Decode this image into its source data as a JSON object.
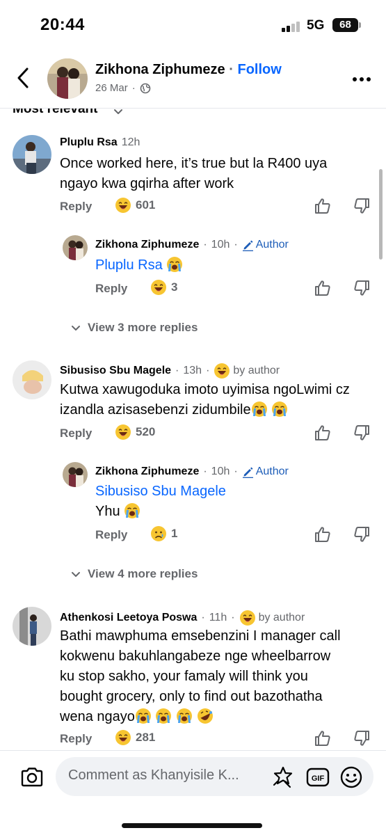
{
  "status_bar": {
    "time": "20:44",
    "network": "5G",
    "battery": "68"
  },
  "header": {
    "name": "Zikhona Ziphumeze",
    "separator": "·",
    "follow_label": "Follow",
    "date": "26 Mar",
    "date_sep": "·"
  },
  "sort": {
    "label": "Most relevant"
  },
  "comments": [
    {
      "name": "Pluplu Rsa",
      "time": "12h",
      "text": "Once worked here, it’s true but la R400 uya ngayo kwa gqirha after work",
      "reply_label": "Reply",
      "reaction_emoji": "laugh",
      "reaction_count": "601",
      "replies": [
        {
          "name": "Zikhona Ziphumeze",
          "time": "10h",
          "author_label": "Author",
          "mention": "Pluplu Rsa",
          "text": "",
          "reply_label": "Reply",
          "reaction_emoji": "laugh",
          "reaction_count": "3"
        }
      ],
      "view_more": "View 3 more replies"
    },
    {
      "name": "Sibusiso Sbu Magele",
      "time": "13h",
      "by_author": "by author",
      "text": "Kutwa xawugoduka imoto uyimisa ngoLwimi cz izandla azisasebenzi zidumbile",
      "reply_label": "Reply",
      "reaction_emoji": "laugh",
      "reaction_count": "520",
      "replies": [
        {
          "name": "Zikhona Ziphumeze",
          "time": "10h",
          "author_label": "Author",
          "mention": "Sibusiso Sbu Magele",
          "text": "Yhu",
          "reply_label": "Reply",
          "reaction_emoji": "sad",
          "reaction_count": "1"
        }
      ],
      "view_more": "View 4 more replies"
    },
    {
      "name": "Athenkosi Leetoya Poswa",
      "time": "11h",
      "by_author": "by author",
      "text_lines": [
        "Bathi mawphuma emsebenzini I manager call",
        "kokwenu bakuhlangabeze nge wheelbarrow",
        "ku stop sakho, your famaly will think you",
        "bought grocery, only to find out bazothatha",
        "wena ngayo"
      ],
      "reply_label": "Reply",
      "reaction_emoji": "laugh",
      "reaction_count": "281"
    }
  ],
  "footer": {
    "placeholder": "Comment as Khanyisile K..."
  },
  "colors": {
    "link_blue": "#0866ff",
    "meta_grey": "#65676b",
    "author_blue": "#1d5db8"
  }
}
